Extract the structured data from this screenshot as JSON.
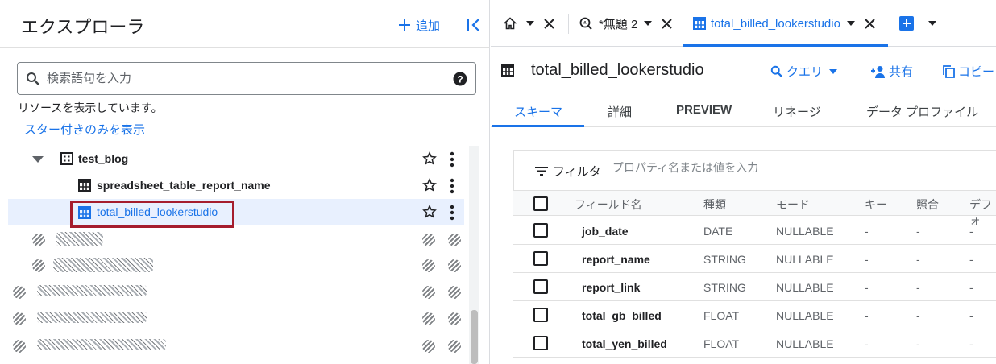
{
  "explorer": {
    "title": "エクスプローラ",
    "add_label": "追加",
    "search_placeholder": "検索語句を入力",
    "resources_text": "リソースを表示しています。",
    "starred_link": "スター付きのみを表示",
    "tree": [
      {
        "label": "test_blog",
        "type": "dataset"
      },
      {
        "label": "spreadsheet_table_report_name",
        "type": "table"
      },
      {
        "label": "total_billed_lookerstudio",
        "type": "table",
        "selected": true
      }
    ]
  },
  "tabs": [
    {
      "label": "",
      "icon": "home-icon"
    },
    {
      "label": "*無題 2",
      "icon": "query-icon"
    },
    {
      "label": "total_billed_lookerstudio",
      "icon": "table-icon",
      "active": true
    }
  ],
  "table": {
    "title": "total_billed_lookerstudio",
    "actions": {
      "query": "クエリ",
      "share": "共有",
      "copy": "コピー"
    }
  },
  "subtabs": [
    "スキーマ",
    "詳細",
    "PREVIEW",
    "リネージ",
    "データ プロファイル"
  ],
  "filter": {
    "label": "フィルタ",
    "placeholder": "プロパティ名または値を入力"
  },
  "schema": {
    "headers": [
      "フィールド名",
      "種類",
      "モード",
      "キー",
      "照合",
      "デフォ"
    ],
    "rows": [
      {
        "name": "job_date",
        "type": "DATE",
        "mode": "NULLABLE",
        "key": "-",
        "collation": "-",
        "default": "-"
      },
      {
        "name": "report_name",
        "type": "STRING",
        "mode": "NULLABLE",
        "key": "-",
        "collation": "-",
        "default": "-"
      },
      {
        "name": "report_link",
        "type": "STRING",
        "mode": "NULLABLE",
        "key": "-",
        "collation": "-",
        "default": "-"
      },
      {
        "name": "total_gb_billed",
        "type": "FLOAT",
        "mode": "NULLABLE",
        "key": "-",
        "collation": "-",
        "default": "-"
      },
      {
        "name": "total_yen_billed",
        "type": "FLOAT",
        "mode": "NULLABLE",
        "key": "-",
        "collation": "-",
        "default": "-"
      }
    ]
  },
  "colors": {
    "accent": "#1a73e8",
    "highlight_border": "#a51d2d",
    "selected_bg": "#e8f0fe"
  }
}
